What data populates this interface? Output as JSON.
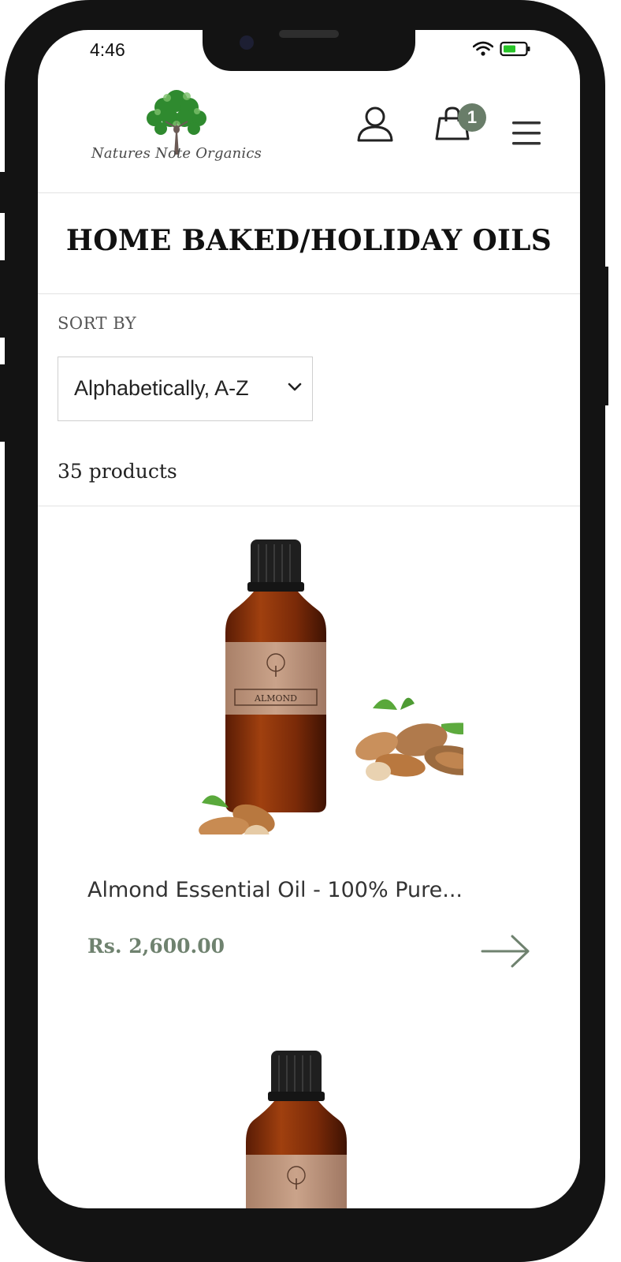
{
  "status_bar": {
    "time": "4:46"
  },
  "header": {
    "logo_text": "Natures Note Organics",
    "cart_count": "1"
  },
  "collection": {
    "title": "HOME BAKED/HOLIDAY OILS",
    "sort_label": "SORT BY",
    "sort_value": "Alphabetically, A-Z",
    "product_count": "35 products"
  },
  "products": [
    {
      "name": "Almond Essential Oil - 100% Pure...",
      "price": "Rs. 2,600.00",
      "label_text": "ALMOND"
    }
  ],
  "icons": {
    "account": "user-icon",
    "cart": "shopping-bag-icon",
    "menu": "hamburger-icon",
    "sort": "chevron-down-icon",
    "product_link": "arrow-right-icon"
  },
  "colors": {
    "accent": "#697d69",
    "price": "#6f826f",
    "frame": "#131313"
  }
}
